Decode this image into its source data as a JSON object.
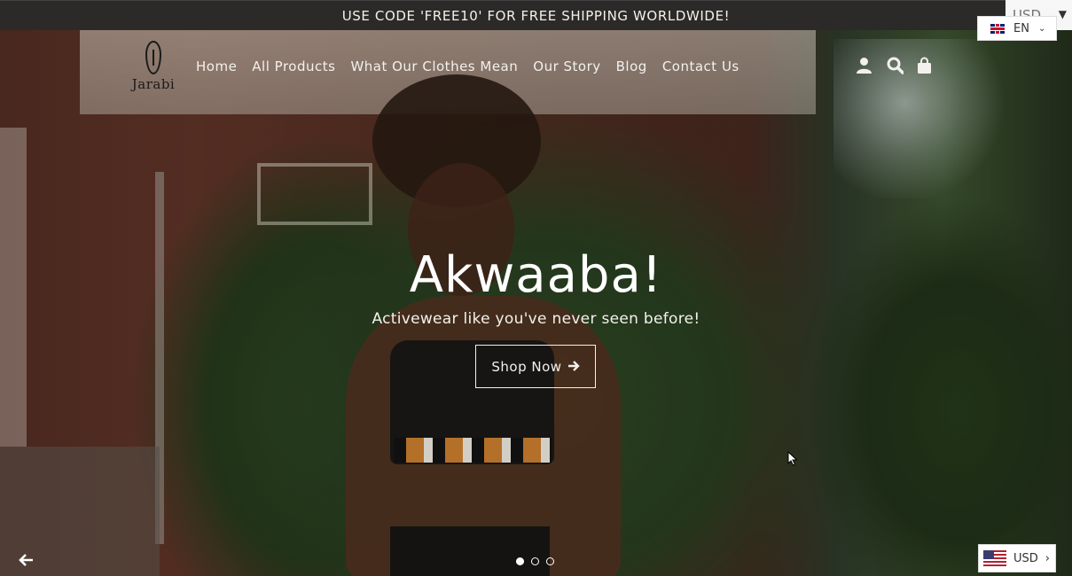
{
  "announcement": "USE CODE 'FREE10' FOR FREE SHIPPING WORLDWIDE!",
  "currency_top": {
    "label": "USD"
  },
  "language": {
    "code": "EN",
    "flag": "uk-flag-icon"
  },
  "logo": {
    "text": "Jarabi"
  },
  "nav": {
    "items": [
      {
        "label": "Home"
      },
      {
        "label": "All Products"
      },
      {
        "label": "What Our Clothes Mean"
      },
      {
        "label": "Our Story"
      },
      {
        "label": "Blog"
      },
      {
        "label": "Contact Us"
      }
    ]
  },
  "header_icons": [
    "account-icon",
    "search-icon",
    "cart-icon"
  ],
  "hero": {
    "title": "Akwaaba!",
    "subtitle": "Activewear like you've never seen before!",
    "cta_label": "Shop Now",
    "slides_total": 3,
    "active_slide": 1
  },
  "currency_bottom": {
    "label": "USD",
    "flag": "us-flag-icon"
  },
  "colors": {
    "announcement_bg": "#2b2a28",
    "text_light": "#f3f1ec"
  }
}
